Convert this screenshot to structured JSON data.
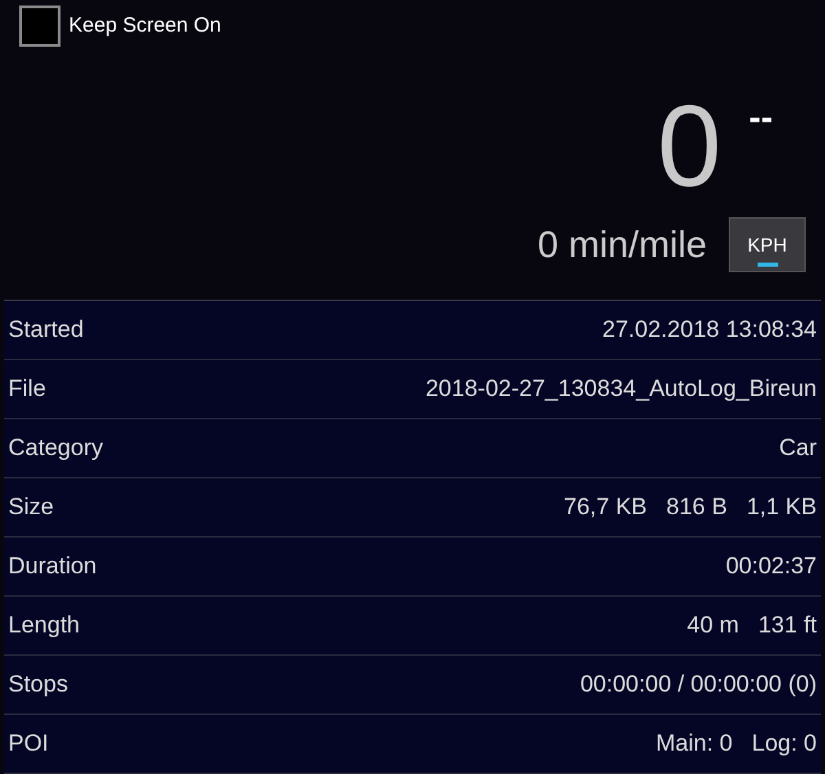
{
  "keep_screen_on": {
    "label": "Keep Screen On",
    "checked": false
  },
  "speed": {
    "value": "0",
    "unit": "--"
  },
  "pace": "0 min/mile",
  "unit_toggle": {
    "label": "KPH",
    "on": true
  },
  "details": [
    {
      "label": "Started",
      "values": [
        "27.02.2018 13:08:34"
      ]
    },
    {
      "label": "File",
      "values": [
        "2018-02-27_130834_AutoLog_Bireun"
      ]
    },
    {
      "label": "Category",
      "values": [
        "Car"
      ]
    },
    {
      "label": "Size",
      "values": [
        "76,7 KB",
        "816 B",
        "1,1 KB"
      ]
    },
    {
      "label": "Duration",
      "values": [
        "00:02:37"
      ]
    },
    {
      "label": "Length",
      "values": [
        "40 m",
        "131 ft"
      ]
    },
    {
      "label": "Stops",
      "values": [
        "00:00:00 / 00:00:00 (0)"
      ]
    },
    {
      "label": "POI",
      "values": [
        "Main: 0",
        "Log: 0"
      ]
    }
  ]
}
